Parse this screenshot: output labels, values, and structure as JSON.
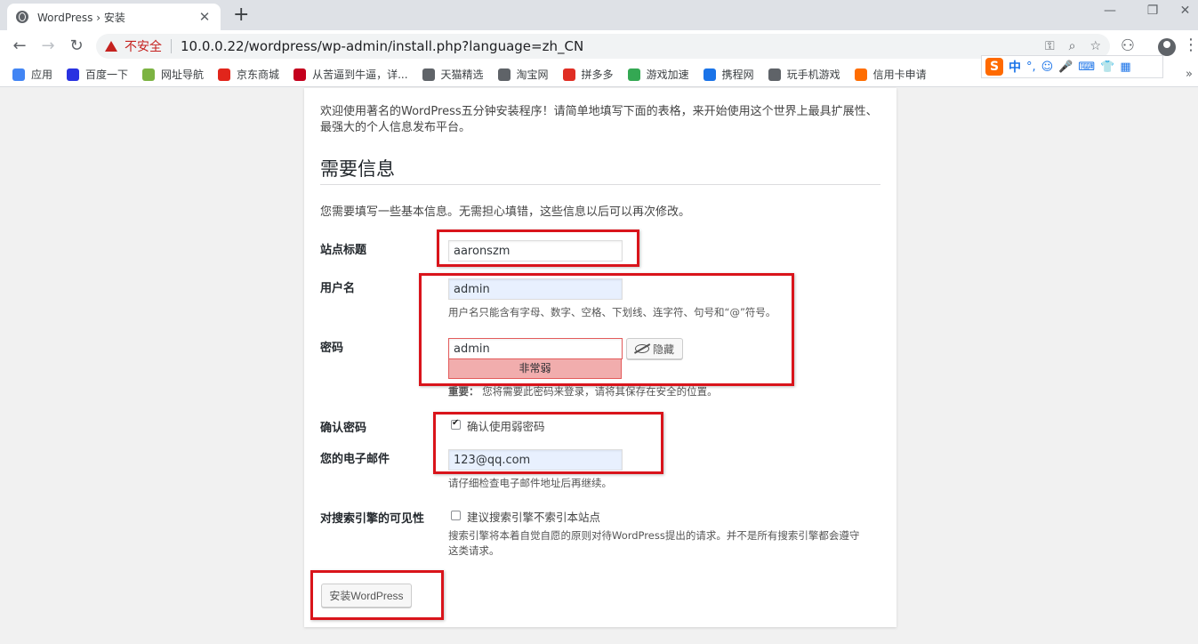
{
  "browser": {
    "tab_title": "WordPress › 安装",
    "tab_close": "✕",
    "new_tab": "+",
    "security_label": "不安全",
    "url": "10.0.0.22/wordpress/wp-admin/install.php?language=zh_CN",
    "window_controls": {
      "minimize": "—",
      "restore": "❐",
      "close": "✕"
    },
    "icons": {
      "key": "key-icon",
      "zoom": "zoom-icon",
      "star": "star-icon"
    },
    "bookmarks": [
      {
        "label": "应用",
        "color": "#4285f4"
      },
      {
        "label": "百度一下",
        "color": "#2932e1"
      },
      {
        "label": "网址导航",
        "color": "#7cb342"
      },
      {
        "label": "京东商城",
        "color": "#e1251b"
      },
      {
        "label": "从苦逼到牛逼，详...",
        "color": "#c4001d"
      },
      {
        "label": "天猫精选",
        "color": "#5f6368"
      },
      {
        "label": "淘宝网",
        "color": "#5f6368"
      },
      {
        "label": "拼多多",
        "color": "#e02e24"
      },
      {
        "label": "游戏加速",
        "color": "#34a853"
      },
      {
        "label": "携程网",
        "color": "#1a73e8"
      },
      {
        "label": "玩手机游戏",
        "color": "#5f6368"
      },
      {
        "label": "信用卡申请",
        "color": "#ff6d00"
      }
    ],
    "bookmarks_more": "»",
    "ime": {
      "logo": "S",
      "mode": "中",
      "punct": "°,",
      "face": "☺",
      "mic": "🎤",
      "kbd": "⌨",
      "shirt": "👕",
      "grid": "▦"
    }
  },
  "page": {
    "intro": "欢迎使用著名的WordPress五分钟安装程序！请简单地填写下面的表格，来开始使用这个世界上最具扩展性、最强大的个人信息发布平台。",
    "section_title": "需要信息",
    "subintro": "您需要填写一些基本信息。无需担心填错，这些信息以后可以再次修改。",
    "fields": {
      "site_title": {
        "label": "站点标题",
        "value": "aaronszm"
      },
      "username": {
        "label": "用户名",
        "value": "admin",
        "hint": "用户名只能含有字母、数字、空格、下划线、连字符、句号和“@”符号。"
      },
      "password": {
        "label": "密码",
        "value": "admin",
        "strength": "非常弱",
        "hide_label": "隐藏",
        "important_prefix": "重要：",
        "important": "您将需要此密码来登录，请将其保存在安全的位置。"
      },
      "confirm": {
        "label": "确认密码",
        "checkbox_label": "确认使用弱密码",
        "checked": true
      },
      "email": {
        "label": "您的电子邮件",
        "value": "123@qq.com",
        "hint": "请仔细检查电子邮件地址后再继续。"
      },
      "visibility": {
        "label": "对搜索引擎的可见性",
        "checkbox_label": "建议搜索引擎不索引本站点",
        "checked": false,
        "hint": "搜索引擎将本着自觉自愿的原则对待WordPress提出的请求。并不是所有搜索引擎都会遵守这类请求。"
      }
    },
    "install_button": "安装WordPress"
  }
}
